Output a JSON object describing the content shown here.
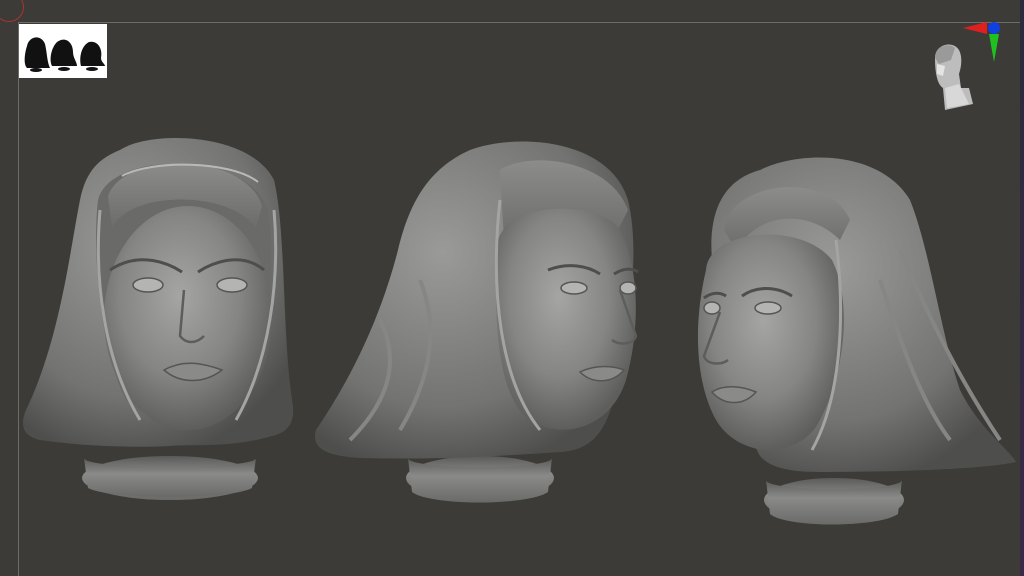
{
  "viewport": {
    "background": "#3c3b37",
    "thumbnail_alt": "",
    "models": [
      {
        "name": "head-front"
      },
      {
        "name": "head-right-three-quarter"
      },
      {
        "name": "head-left-three-quarter"
      }
    ],
    "axis_colors": {
      "x": "#e02020",
      "y": "#20c020",
      "z": "#1040e0"
    }
  }
}
